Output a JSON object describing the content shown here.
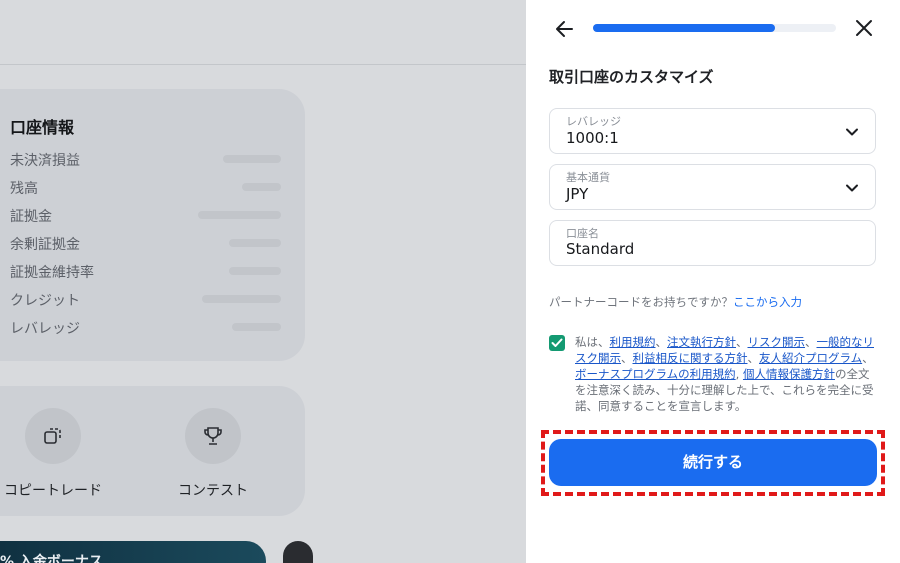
{
  "background": {
    "account_info": {
      "title": "口座情報",
      "rows": [
        "未決済損益",
        "残高",
        "証拠金",
        "余剰証拠金",
        "証拠金維持率",
        "クレジット",
        "レバレッジ"
      ]
    },
    "actions": [
      {
        "label": "コピートレード",
        "icon": "copy-icon"
      },
      {
        "label": "コンテスト",
        "icon": "trophy-icon"
      }
    ],
    "promo_text": "% 入金ボーナス"
  },
  "panel": {
    "progress": 0.75,
    "heading": "取引口座のカスタマイズ",
    "leverage": {
      "label": "レバレッジ",
      "value": "1000:1"
    },
    "currency": {
      "label": "基本通貨",
      "value": "JPY"
    },
    "account_name": {
      "label": "口座名",
      "value": "Standard"
    },
    "partner_text": "パートナーコードをお持ちですか？",
    "partner_link": "ここから入力",
    "terms": {
      "prefix": "私は、",
      "links": [
        "利用規約",
        "注文執行方針",
        "リスク開示",
        "一般的なリスク開示",
        "利益相反に関する方針",
        "友人紹介プログラム",
        "ボーナスプログラムの利用規約",
        "個人情報保護方針"
      ],
      "sep": "、",
      "sep_comma": ", ",
      "suffix": "の全文を注意深く読み、十分に理解した上で、これらを完全に受諾、同意することを宣言します。"
    },
    "continue_label": "続行する",
    "colors": {
      "accent": "#1a6cf0",
      "checkbox": "#149a72",
      "highlight": "#e01919"
    }
  }
}
